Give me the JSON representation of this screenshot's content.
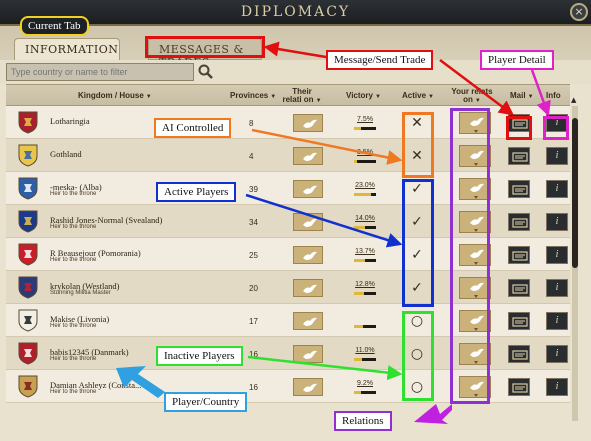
{
  "window": {
    "title": "DIPLOMACY",
    "close_label": "×"
  },
  "tabs": [
    {
      "label": "INFORMATION",
      "active": true
    },
    {
      "label": "MESSAGES & TRADES",
      "active": false
    }
  ],
  "filter": {
    "placeholder": "Type country or name to filter"
  },
  "columns": {
    "kingdom": "Kingdom / House",
    "provinces": "Provinces",
    "their_relation": "Their relati on",
    "victory": "Victory",
    "active": "Active",
    "your_relation": "Your relats on",
    "mail": "Mail",
    "info": "Info"
  },
  "rows": [
    {
      "name": "Lotharingia",
      "subtitle": "",
      "provinces": "8",
      "victory": "7.5%",
      "victory_fill": 0.3,
      "active": "✕",
      "shield_color": "#a8202a",
      "shield_accent": "#e8c64a"
    },
    {
      "name": "Gothland",
      "subtitle": "",
      "provinces": "4",
      "victory": "3.5%",
      "victory_fill": 0.15,
      "active": "✕",
      "shield_color": "#e8c64a",
      "shield_accent": "#2d5fa8"
    },
    {
      "name": "-meska- (Alba)",
      "subtitle": "Heir to the throne",
      "provinces": "39",
      "victory": "23.0%",
      "victory_fill": 0.75,
      "active": "✓",
      "shield_color": "#2d5fa8",
      "shield_accent": "#ffffff"
    },
    {
      "name": "Rashid Jones-Normal (Svealand)",
      "subtitle": "Heir to the throne",
      "provinces": "34",
      "victory": "14.0%",
      "victory_fill": 0.5,
      "active": "✓",
      "shield_color": "#1c3a8a",
      "shield_accent": "#e8c64a"
    },
    {
      "name": "R Beausejour (Pomorania)",
      "subtitle": "Heir to the throne",
      "provinces": "25",
      "victory": "13.7%",
      "victory_fill": 0.48,
      "active": "✓",
      "shield_color": "#c8202a",
      "shield_accent": "#ffffff"
    },
    {
      "name": "krykolan (Westland)",
      "subtitle": "Stunning Militia Master",
      "provinces": "20",
      "victory": "12.8%",
      "victory_fill": 0.45,
      "active": "✓",
      "shield_color": "#2a3a7a",
      "shield_accent": "#c8202a"
    },
    {
      "name": "Makise (Livonia)",
      "subtitle": "Heir to the throne",
      "provinces": "17",
      "victory": "",
      "victory_fill": 0.4,
      "active": "○",
      "shield_color": "#f2efe6",
      "shield_accent": "#1a1a1a"
    },
    {
      "name": "babis12345 (Danmark)",
      "subtitle": "Heir to the throne",
      "provinces": "16",
      "victory": "11.0%",
      "victory_fill": 0.38,
      "active": "○",
      "shield_color": "#b0202a",
      "shield_accent": "#ffffff"
    },
    {
      "name": "Damian Ashleyz (Consta...",
      "subtitle": "Heir to the throne",
      "provinces": "16",
      "victory": "9.2%",
      "victory_fill": 0.32,
      "active": "○",
      "shield_color": "#c8a050",
      "shield_accent": "#7a1a1a"
    }
  ],
  "annotations": {
    "current_tab": "Current Tab",
    "message_trade": "Message/Send Trade",
    "player_detail": "Player Detail",
    "ai_controlled": "AI Controlled",
    "active_players": "Active Players",
    "inactive_players": "Inactive Players",
    "player_country": "Player/Country",
    "relations": "Relations"
  },
  "colors": {
    "red": "#e01010",
    "orange": "#f07820",
    "blue": "#1030d0",
    "green": "#30e030",
    "purple": "#9030d0",
    "magenta": "#e020c8",
    "yellow": "#f0d020",
    "lightblue": "#30a0e0"
  }
}
